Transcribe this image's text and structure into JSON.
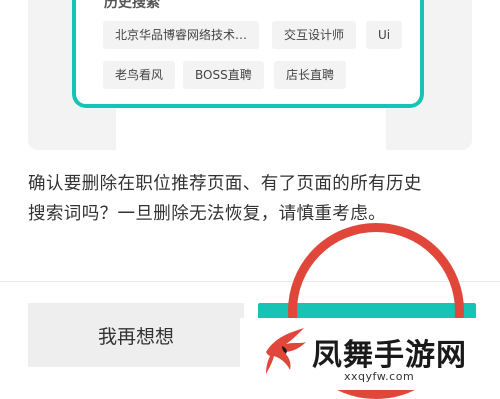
{
  "history": {
    "title": "历史搜索",
    "chips": [
      "北京华品博睿网络技术…",
      "交互设计师",
      "Ui",
      "老鸟看风",
      "BOSS直聘",
      "店长直聘"
    ]
  },
  "dialog": {
    "message_line1": "确认要删除在职位推荐页面、有了页面的所有历史",
    "message_line2": "搜索词吗？一旦删除无法恢复，请慎重考虑。",
    "cancel_label": "我再想想"
  },
  "watermark": {
    "title": "凤舞手游网",
    "url": "xxqyfw.com"
  },
  "colors": {
    "accent": "#16c3b4",
    "highlight_circle": "#e0473a"
  }
}
